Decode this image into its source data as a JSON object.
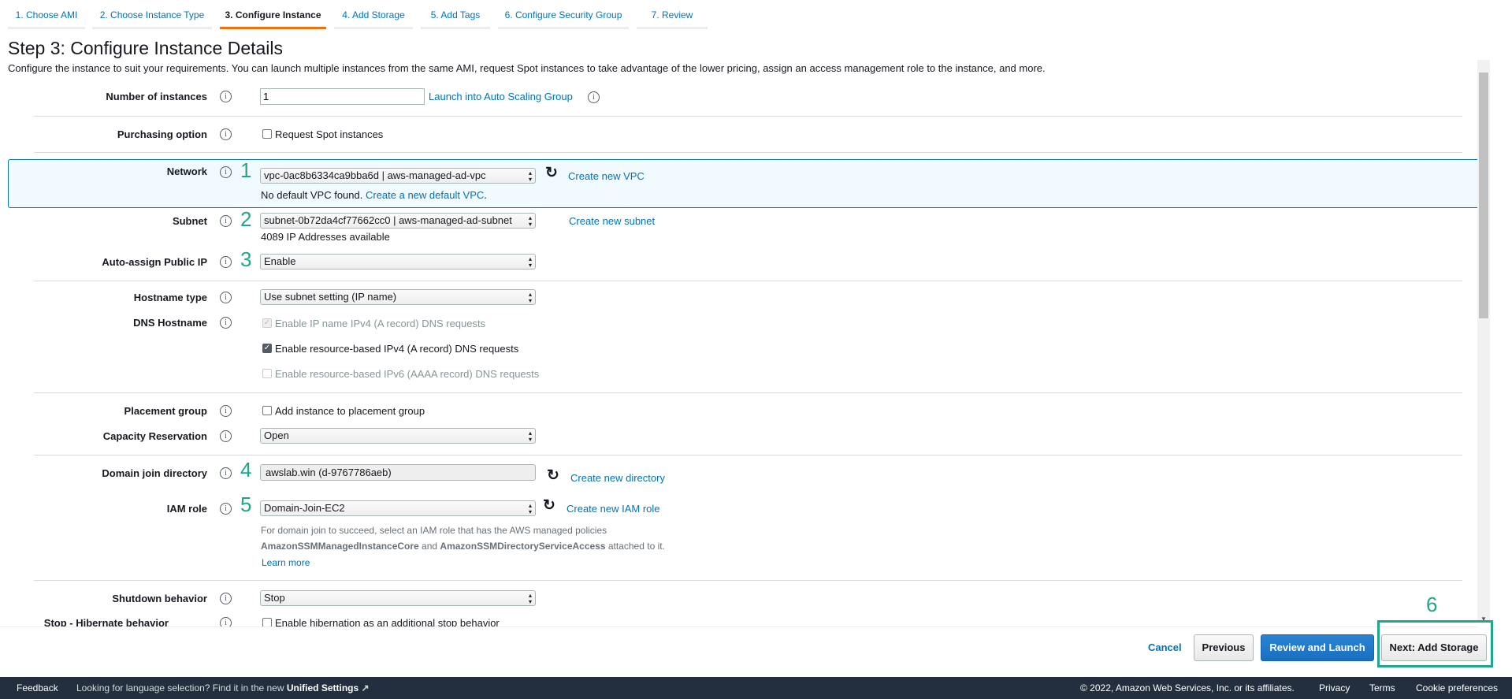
{
  "tabs": [
    {
      "label": "1. Choose AMI"
    },
    {
      "label": "2. Choose Instance Type"
    },
    {
      "label": "3. Configure Instance",
      "active": true
    },
    {
      "label": "4. Add Storage"
    },
    {
      "label": "5. Add Tags"
    },
    {
      "label": "6. Configure Security Group"
    },
    {
      "label": "7. Review"
    }
  ],
  "page": {
    "title": "Step 3: Configure Instance Details",
    "description": "Configure the instance to suit your requirements. You can launch multiple instances from the same AMI, request Spot instances to take advantage of the lower pricing, assign an access management role to the instance, and more."
  },
  "form": {
    "number_of_instances": {
      "label": "Number of instances",
      "value": "1",
      "link": "Launch into Auto Scaling Group"
    },
    "purchasing": {
      "label": "Purchasing option",
      "checkbox": "Request Spot instances",
      "checked": false
    },
    "network": {
      "label": "Network",
      "value": "vpc-0ac8b6334ca9bba6d | aws-managed-ad-vpc",
      "link": "Create new VPC",
      "note": "No default VPC found.",
      "note_link": "Create a new default VPC",
      "note_end": "."
    },
    "subnet": {
      "label": "Subnet",
      "value": "subnet-0b72da4cf77662cc0 | aws-managed-ad-subnet",
      "link": "Create new subnet",
      "note": "4089 IP Addresses available"
    },
    "public_ip": {
      "label": "Auto-assign Public IP",
      "value": "Enable"
    },
    "hostname_type": {
      "label": "Hostname type",
      "value": "Use subnet setting (IP name)"
    },
    "dns": {
      "label": "DNS Hostname",
      "options": [
        {
          "label": "Enable IP name IPv4 (A record) DNS requests",
          "checked": true,
          "disabled": true
        },
        {
          "label": "Enable resource-based IPv4 (A record) DNS requests",
          "checked": true,
          "disabled": false
        },
        {
          "label": "Enable resource-based IPv6 (AAAA record) DNS requests",
          "checked": false,
          "disabled": true
        }
      ]
    },
    "placement": {
      "label": "Placement group",
      "checkbox": "Add instance to placement group"
    },
    "capacity": {
      "label": "Capacity Reservation",
      "value": "Open"
    },
    "domain": {
      "label": "Domain join directory",
      "value": "awslab.win (d-9767786aeb)",
      "link": "Create new directory"
    },
    "iam": {
      "label": "IAM role",
      "value": "Domain-Join-EC2",
      "link": "Create new IAM role",
      "help1": "For domain join to succeed, select an IAM role that has the AWS managed policies",
      "policy1": "AmazonSSMManagedInstanceCore",
      "and": " and ",
      "policy2": "AmazonSSMDirectoryServiceAccess",
      "help2": " attached to it.",
      "learn_more": "Learn more"
    },
    "shutdown": {
      "label": "Shutdown behavior",
      "value": "Stop"
    },
    "hibernate": {
      "label": "Stop - Hibernate behavior",
      "checkbox": "Enable hibernation as an additional stop behavior"
    }
  },
  "annotations": [
    "1",
    "2",
    "3",
    "4",
    "5",
    "6"
  ],
  "buttons": {
    "cancel": "Cancel",
    "previous": "Previous",
    "review": "Review and Launch",
    "next": "Next: Add Storage"
  },
  "footer": {
    "feedback": "Feedback",
    "lang": "Looking for language selection? Find it in the new ",
    "unified": "Unified Settings",
    "copyright": "© 2022, Amazon Web Services, Inc. or its affiliates.",
    "privacy": "Privacy",
    "terms": "Terms",
    "cookie": "Cookie preferences"
  },
  "colors": {
    "accent": "#ec7211",
    "link": "#0073bb",
    "primary": "#0073bb",
    "annotation": "#1fa78a",
    "footer": "#232f3e"
  }
}
